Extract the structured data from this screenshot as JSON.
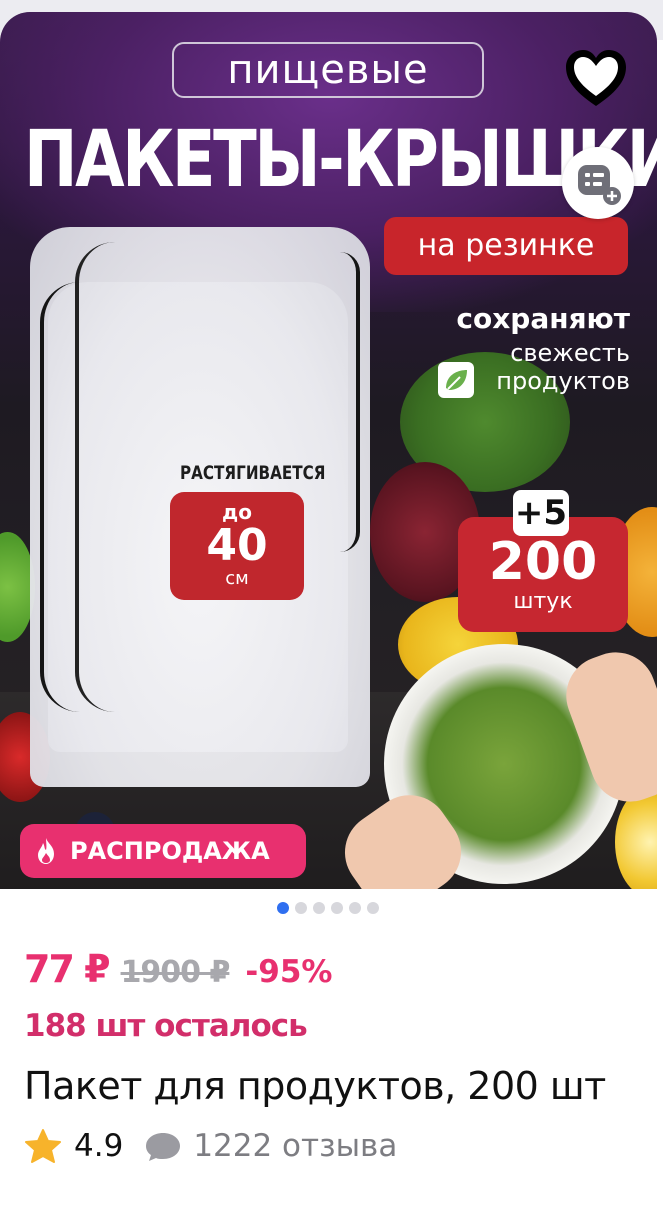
{
  "image": {
    "title_small": "пищевые",
    "title_main": "ПАКЕТЫ-КРЫШКИ",
    "red_badge": "на резинке",
    "keep_line1": "сохраняют",
    "keep_line2": "свежесть",
    "keep_line3": "продуктов",
    "stretch_label": "РАСТЯГИВАЕТСЯ",
    "stretch_prefix": "до",
    "stretch_value": "40",
    "stretch_unit": "см",
    "bonus": "+5",
    "count_value": "200",
    "count_unit": "штук"
  },
  "sale_badge": {
    "label": "РАСПРОДАЖА",
    "icon": "fire-icon",
    "color": "#e8306f"
  },
  "gallery": {
    "dots_total": 6,
    "active_index": 0
  },
  "price": {
    "current": "77 ₽",
    "old": "1900 ₽",
    "discount": "-95%",
    "accent_color": "#e8306f"
  },
  "stock_text": "188 шт осталось",
  "product_name": "Пакет для продуктов, 200 шт",
  "rating": {
    "value": "4.9",
    "reviews": "1222 отзыва",
    "star_color": "#f7b32b"
  },
  "actions": {
    "favorite_icon": "heart-icon",
    "compare_icon": "compare-list-add-icon"
  }
}
